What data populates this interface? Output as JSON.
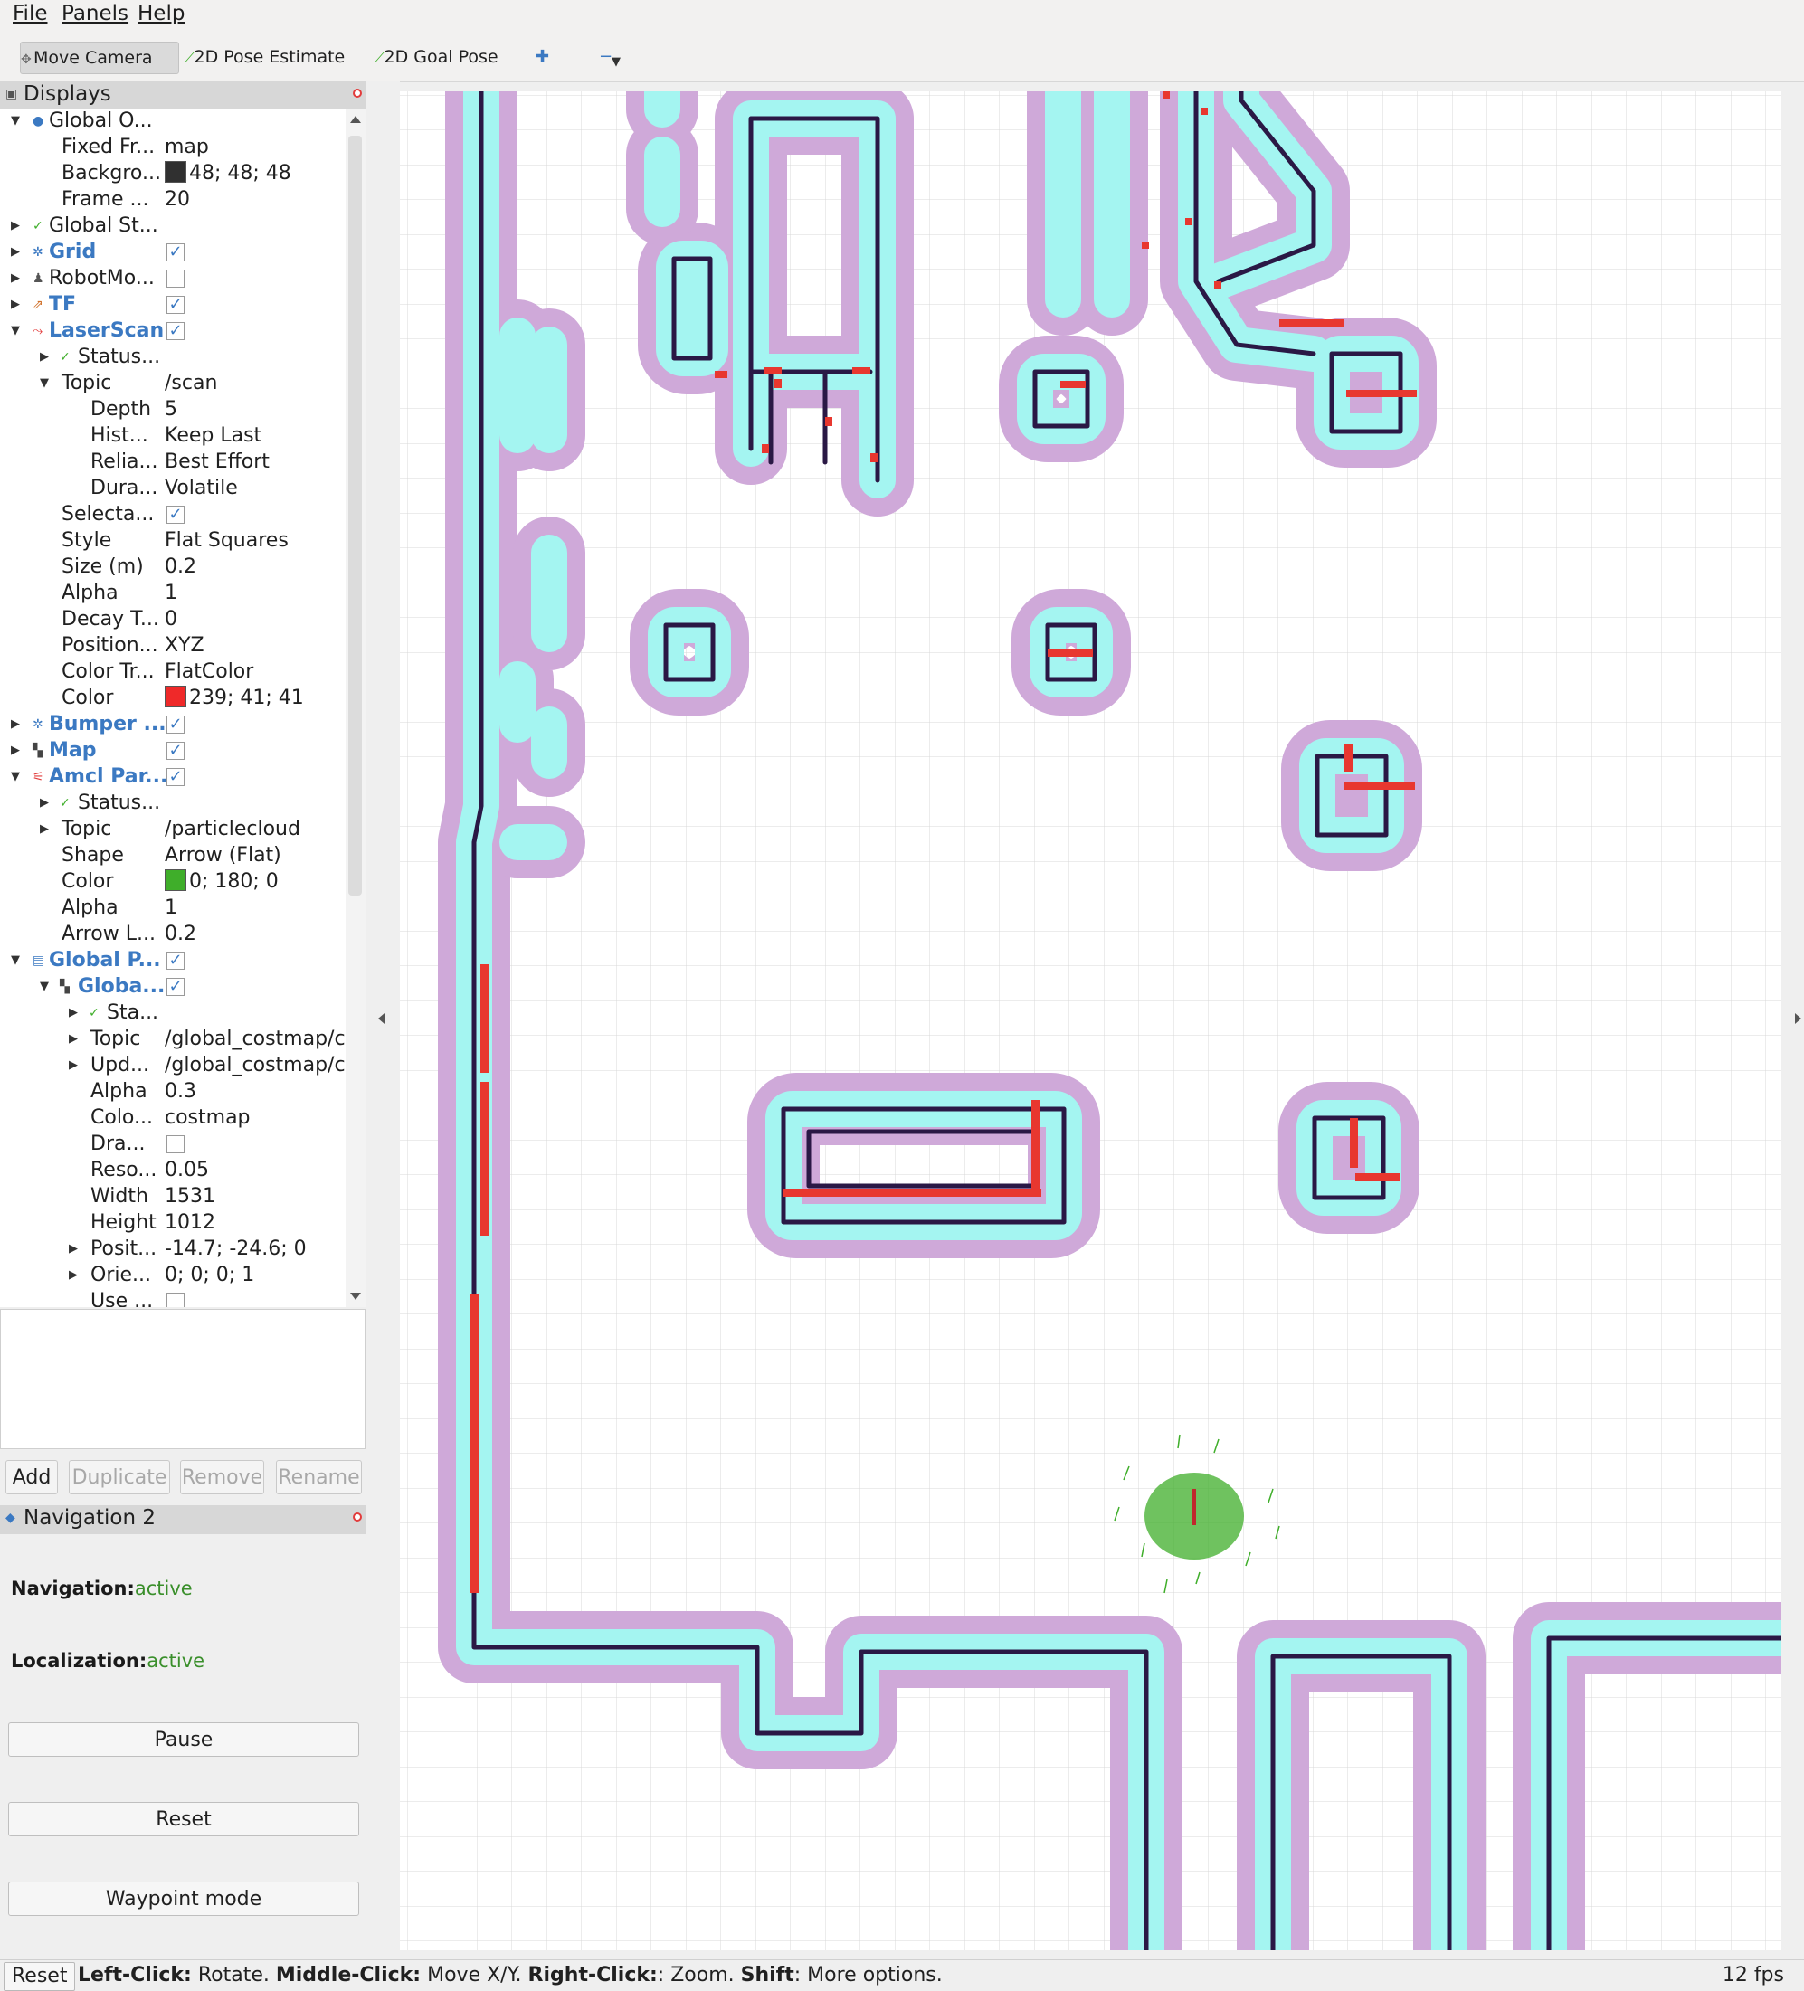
{
  "menu": {
    "file": "File",
    "panels": "Panels",
    "help": "Help"
  },
  "toolbar": {
    "move_camera": "Move Camera",
    "pose_estimate": "2D Pose Estimate",
    "goal_pose": "2D Goal Pose"
  },
  "displays": {
    "title": "Displays",
    "rows": [
      {
        "name": "Global O...",
        "value": ""
      },
      {
        "name": "Fixed Fr...",
        "value": "map"
      },
      {
        "name": "Backgro...",
        "value": "48; 48; 48"
      },
      {
        "name": "Frame ...",
        "value": "20"
      },
      {
        "name": "Global St...",
        "value": ""
      },
      {
        "name": "Grid",
        "value": ""
      },
      {
        "name": "RobotMo...",
        "value": ""
      },
      {
        "name": "TF",
        "value": ""
      },
      {
        "name": "LaserScan",
        "value": ""
      },
      {
        "name": "Status...",
        "value": ""
      },
      {
        "name": "Topic",
        "value": "/scan"
      },
      {
        "name": "Depth",
        "value": "5"
      },
      {
        "name": "Hist...",
        "value": "Keep Last"
      },
      {
        "name": "Relia...",
        "value": "Best Effort"
      },
      {
        "name": "Dura...",
        "value": "Volatile"
      },
      {
        "name": "Selecta...",
        "value": ""
      },
      {
        "name": "Style",
        "value": "Flat Squares"
      },
      {
        "name": "Size (m)",
        "value": "0.2"
      },
      {
        "name": "Alpha",
        "value": "1"
      },
      {
        "name": "Decay T...",
        "value": "0"
      },
      {
        "name": "Position...",
        "value": "XYZ"
      },
      {
        "name": "Color Tr...",
        "value": "FlatColor"
      },
      {
        "name": "Color",
        "value": "239; 41; 41"
      },
      {
        "name": "Bumper ...",
        "value": ""
      },
      {
        "name": "Map",
        "value": ""
      },
      {
        "name": "Amcl Par...",
        "value": ""
      },
      {
        "name": "Status...",
        "value": ""
      },
      {
        "name": "Topic",
        "value": "/particlecloud"
      },
      {
        "name": "Shape",
        "value": "Arrow (Flat)"
      },
      {
        "name": "Color",
        "value": "0; 180; 0"
      },
      {
        "name": "Alpha",
        "value": "1"
      },
      {
        "name": "Arrow L...",
        "value": "0.2"
      },
      {
        "name": "Global P...",
        "value": ""
      },
      {
        "name": "Globa...",
        "value": ""
      },
      {
        "name": "Sta...",
        "value": ""
      },
      {
        "name": "Topic",
        "value": "/global_costmap/c..."
      },
      {
        "name": "Upd...",
        "value": "/global_costmap/c..."
      },
      {
        "name": "Alpha",
        "value": "0.3"
      },
      {
        "name": "Colo...",
        "value": "costmap"
      },
      {
        "name": "Dra...",
        "value": ""
      },
      {
        "name": "Reso...",
        "value": "0.05"
      },
      {
        "name": "Width",
        "value": "1531"
      },
      {
        "name": "Height",
        "value": "1012"
      },
      {
        "name": "Posit...",
        "value": "-14.7; -24.6; 0"
      },
      {
        "name": "Orie...",
        "value": "0; 0; 0; 1"
      },
      {
        "name": "Use ...",
        "value": ""
      }
    ],
    "buttons": {
      "add": "Add",
      "duplicate": "Duplicate",
      "remove": "Remove",
      "rename": "Rename"
    }
  },
  "colors": {
    "background_swatch": "#303030",
    "laser_color": "#ef2929",
    "particle_color": "#00b400",
    "costmap_inflation": "#c9a7d6",
    "costmap_inscribed": "#9ff8f4",
    "obstacle": "#2a1845"
  },
  "navigation": {
    "title": "Navigation 2",
    "nav_label": "Navigation:",
    "nav_value": "active",
    "loc_label": "Localization:",
    "loc_value": "active",
    "pause": "Pause",
    "reset": "Reset",
    "waypoint": "Waypoint mode"
  },
  "status": {
    "reset": "Reset",
    "left_click": "Left-Click:",
    "left_click_desc": " Rotate. ",
    "middle_click": "Middle-Click:",
    "middle_click_desc": " Move X/Y. ",
    "right_click": "Right-Click:",
    "right_click_desc": ": Zoom. ",
    "shift": "Shift",
    "shift_desc": ": More options.",
    "fps": "12 fps"
  }
}
